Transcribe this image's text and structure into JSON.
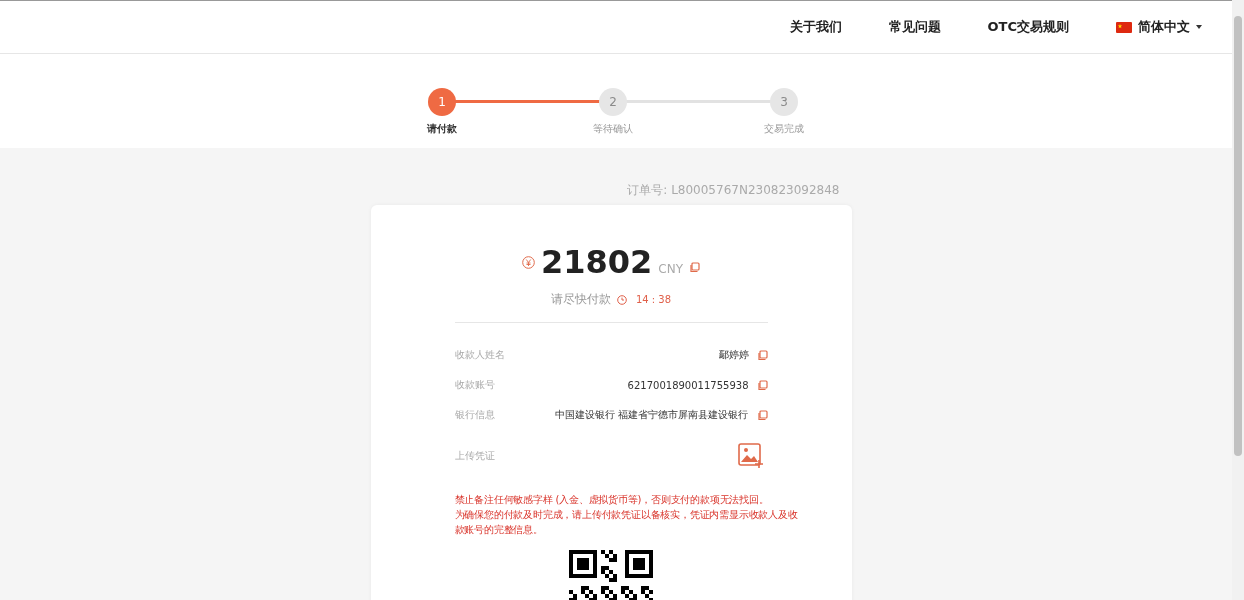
{
  "nav": {
    "links": [
      "关于我们",
      "常见问题",
      "OTC交易规则"
    ],
    "language": "简体中文"
  },
  "steps": [
    {
      "number": "1",
      "label": "请付款",
      "selected": true
    },
    {
      "number": "2",
      "label": "等待确认",
      "selected": false
    },
    {
      "number": "3",
      "label": "交易完成",
      "selected": false
    }
  ],
  "order_number": "订单号: L80005767N230823092848",
  "payment": {
    "amount": "21802",
    "currency": "CNY",
    "prompt": "请尽快付款",
    "countdown": "14 : 38"
  },
  "details": [
    {
      "kind": "copy",
      "label": "收款人姓名",
      "value": "鄢婷婷"
    },
    {
      "kind": "copy",
      "label": "收款账号",
      "value": "6217001890011755938"
    },
    {
      "kind": "copy",
      "label": "银行信息",
      "value": "中国建设银行 福建省宁德市屏南县建设银行"
    },
    {
      "kind": "upload",
      "label": "上传凭证"
    }
  ],
  "warning": [
    "禁止备注任何敏感字样 (入金、虚拟货币等)，否则支付的款项无法找回。",
    "为确保您的付款及时完成，请上传付款凭证以备核实，凭证内需显示收款人及收款账号的完整信息。"
  ]
}
